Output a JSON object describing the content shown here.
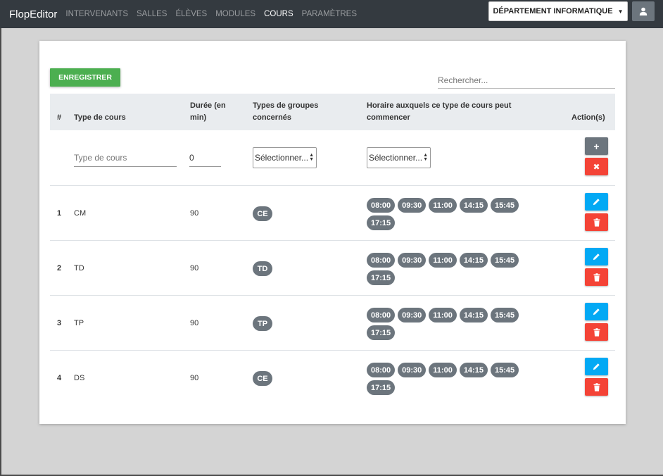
{
  "navbar": {
    "brand": "FlopEditor",
    "items": [
      {
        "label": "INTERVENANTS",
        "active": false
      },
      {
        "label": "SALLES",
        "active": false
      },
      {
        "label": "ÉLÈVES",
        "active": false
      },
      {
        "label": "MODULES",
        "active": false
      },
      {
        "label": "COURS",
        "active": true
      },
      {
        "label": "PARAMÈTRES",
        "active": false
      }
    ],
    "department": "DÉPARTEMENT INFORMATIQUE",
    "user_icon": "user-icon"
  },
  "toolbar": {
    "save_label": "ENREGISTRER",
    "search_placeholder": "Rechercher..."
  },
  "table": {
    "headers": {
      "index": "#",
      "type": "Type de cours",
      "duration_line1": "Durée (en",
      "duration_line2": "min)",
      "groups_line1": "Types de groupes",
      "groups_line2": "concernés",
      "hours_line1": "Horaire auxquels ce type de cours peut",
      "hours_line2": "commencer",
      "actions": "Action(s)"
    },
    "new_row": {
      "type_placeholder": "Type de cours",
      "duration_value": "0",
      "groups_select": "Sélectionner...",
      "hours_select": "Sélectionner...",
      "add_icon": "plus-icon",
      "cancel_icon": "times-icon"
    },
    "rows": [
      {
        "index": "1",
        "type": "CM",
        "duration": "90",
        "group": "CE",
        "times": [
          "08:00",
          "09:30",
          "11:00",
          "14:15",
          "15:45",
          "17:15"
        ]
      },
      {
        "index": "2",
        "type": "TD",
        "duration": "90",
        "group": "TD",
        "times": [
          "08:00",
          "09:30",
          "11:00",
          "14:15",
          "15:45",
          "17:15"
        ]
      },
      {
        "index": "3",
        "type": "TP",
        "duration": "90",
        "group": "TP",
        "times": [
          "08:00",
          "09:30",
          "11:00",
          "14:15",
          "15:45",
          "17:15"
        ]
      },
      {
        "index": "4",
        "type": "DS",
        "duration": "90",
        "group": "CE",
        "times": [
          "08:00",
          "09:30",
          "11:00",
          "14:15",
          "15:45",
          "17:15"
        ]
      }
    ],
    "row_actions": {
      "edit_icon": "pencil-icon",
      "delete_icon": "trash-icon"
    }
  },
  "colors": {
    "navbar": "#343a40",
    "save": "#4caf50",
    "edit": "#03a9f4",
    "delete": "#f44336",
    "badge": "#6c757d"
  }
}
